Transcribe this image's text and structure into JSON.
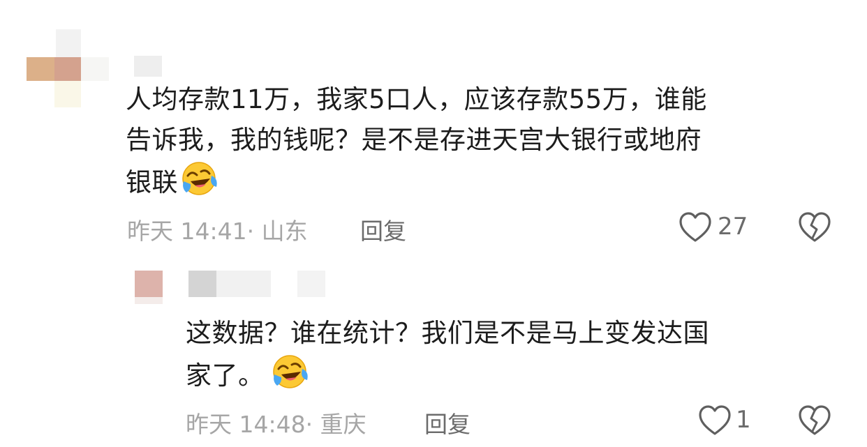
{
  "comments": [
    {
      "text_lines": [
        "人均存款11万，我家5口人，应该存款55万，谁能",
        "告诉我，我的钱呢？是不是存进天宫大银行或地府",
        "银联"
      ],
      "emoji": "laugh-cry-emoji",
      "time": "昨天 14:41",
      "location": "· 山东",
      "reply_label": "回复",
      "like_count": "27"
    },
    {
      "text_lines": [
        "这数据？谁在统计？我们是不是马上变发达国",
        "家了。"
      ],
      "emoji": "laugh-cry-emoji",
      "time": "昨天 14:48",
      "location": "· 重庆",
      "reply_label": "回复",
      "like_count": "1"
    }
  ],
  "colors": {
    "text": "#1c1c1c",
    "meta": "#a6a6a6",
    "action": "#6b6b6b"
  },
  "icons": [
    "heart-icon",
    "broken-heart-icon",
    "laugh-cry-emoji"
  ]
}
